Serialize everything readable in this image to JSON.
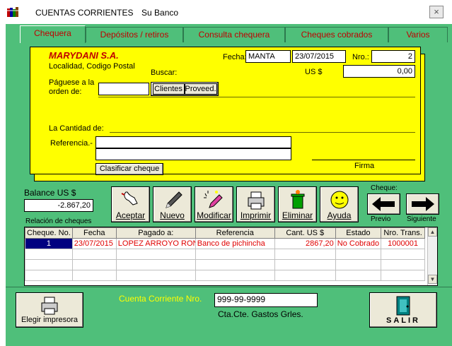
{
  "window": {
    "title": "CUENTAS CORRIENTES",
    "company": "Su Banco",
    "close": "×"
  },
  "tabs": [
    {
      "label": "Chequera"
    },
    {
      "label": "Depósitos / retiros"
    },
    {
      "label": "Consulta chequera"
    },
    {
      "label": "Cheques cobrados"
    },
    {
      "label": "Varios"
    }
  ],
  "check": {
    "company_name": "MARYDANI S.A.",
    "address": "Localidad, Codigo Postal",
    "fecha_label": "Fecha:",
    "fecha_city": "MANTA",
    "fecha_date": "23/07/2015",
    "nro_label": "Nro.:",
    "nro_value": "2",
    "currency_label": "US $",
    "amount": "0,00",
    "buscar_label": "Buscar:",
    "paguese_label_1": "Páguese a la",
    "paguese_label_2": "orden de:",
    "clientes_button": "Clientes",
    "proveed_button": "Proveed.",
    "cantidad_label": "La Cantidad de:",
    "referencia_label": "Referencia.-",
    "clasificar_button": "Clasificar cheque",
    "firma_label": "Firma"
  },
  "balance": {
    "label": "Balance US $",
    "value": "-2.867,20"
  },
  "toolbar": {
    "aceptar": "Aceptar",
    "nuevo": "Nuevo",
    "modificar": "Modificar",
    "imprimir": "Imprimir",
    "eliminar": "Eliminar",
    "ayuda": "Ayuda"
  },
  "nav": {
    "group_label": "Cheque:",
    "previo": "Previo",
    "siguiente": "Siguiente"
  },
  "grid": {
    "caption": "Relación de cheques",
    "columns": [
      "Cheque. No.",
      "Fecha",
      "Pagado a:",
      "Referencia",
      "Cant. US $",
      "Estado",
      "Nro. Trans."
    ],
    "rows": [
      {
        "cheque": "1",
        "fecha": "23/07/2015",
        "pagado": "LOPEZ ARROYO RONI",
        "referencia": "Banco de pichincha",
        "cant": "2867,20",
        "estado": "No Cobrado",
        "trans": "1000001"
      }
    ]
  },
  "footer": {
    "printer_button": "Elegir impresora",
    "cuenta_label": "Cuenta Corriente Nro.",
    "cuenta_value": "999-99-9999",
    "cuenta_desc": "Cta.Cte. Gastos Grles.",
    "salir_button": "SALIR"
  },
  "colors": {
    "background": "#4fbf7a",
    "check": "#ffff00",
    "tab_text": "#c00000",
    "row_text": "#e00000",
    "cuenta_label": "#ffff00"
  }
}
